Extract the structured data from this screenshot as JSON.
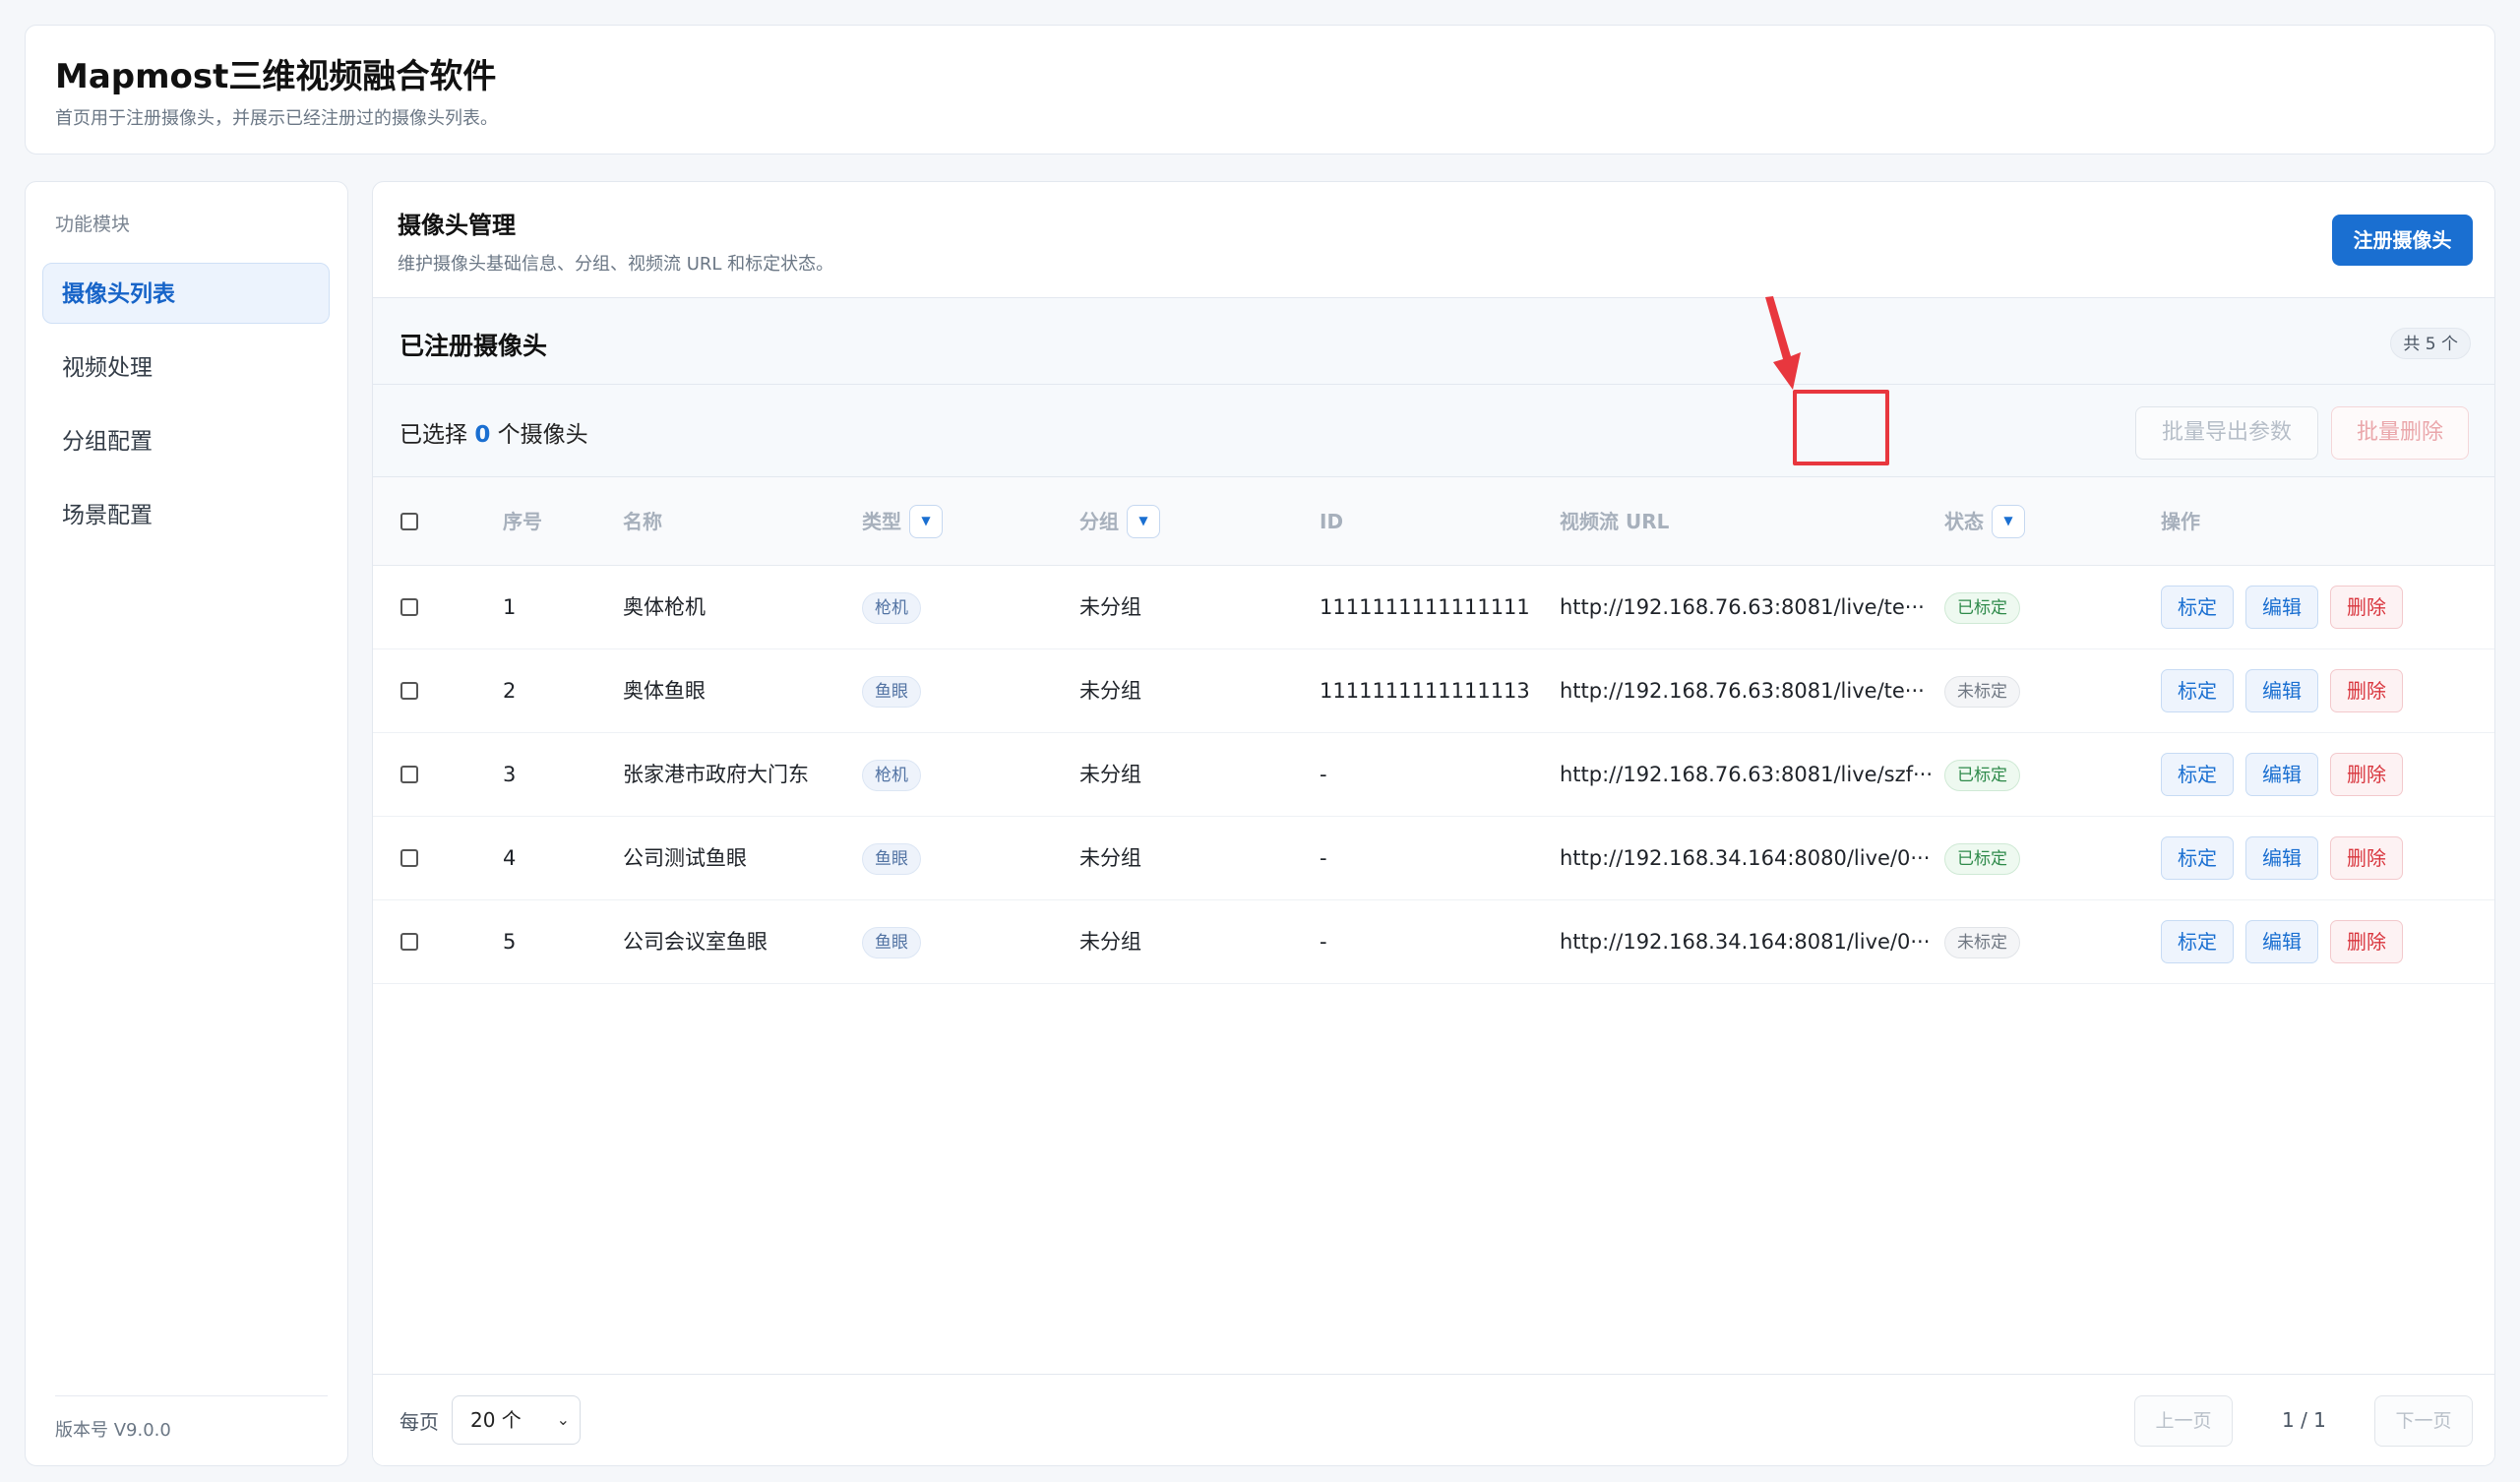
{
  "app": {
    "title": "Mapmost三维视频融合软件",
    "subtitle": "首页用于注册摄像头，并展示已经注册过的摄像头列表。"
  },
  "sidebar": {
    "section_label": "功能模块",
    "items": [
      {
        "label": "摄像头列表",
        "active": true
      },
      {
        "label": "视频处理",
        "active": false
      },
      {
        "label": "分组配置",
        "active": false
      },
      {
        "label": "场景配置",
        "active": false
      }
    ],
    "version": "版本号 V9.0.0"
  },
  "management": {
    "title": "摄像头管理",
    "description": "维护摄像头基础信息、分组、视频流 URL 和标定状态。",
    "register_button": "注册摄像头"
  },
  "list": {
    "title": "已注册摄像头",
    "count_badge": "共 5 个",
    "selection_prefix": "已选择",
    "selection_count": "0",
    "selection_suffix": "个摄像头",
    "export_button": "批量导出参数",
    "batch_delete_button": "批量删除"
  },
  "table": {
    "headers": {
      "index": "序号",
      "name": "名称",
      "type": "类型",
      "group": "分组",
      "id": "ID",
      "url": "视频流 URL",
      "status": "状态",
      "actions": "操作"
    },
    "action_labels": {
      "calibrate": "标定",
      "edit": "编辑",
      "delete": "删除"
    },
    "rows": [
      {
        "index": "1",
        "name": "奥体枪机",
        "type": "枪机",
        "group": "未分组",
        "id": "1111111111111111",
        "url": "http://192.168.76.63:8081/live/te···",
        "status": "已标定",
        "calibrated": true
      },
      {
        "index": "2",
        "name": "奥体鱼眼",
        "type": "鱼眼",
        "group": "未分组",
        "id": "1111111111111113",
        "url": "http://192.168.76.63:8081/live/te···",
        "status": "未标定",
        "calibrated": false
      },
      {
        "index": "3",
        "name": "张家港市政府大门东",
        "type": "枪机",
        "group": "未分组",
        "id": "-",
        "url": "http://192.168.76.63:8081/live/szf···",
        "status": "已标定",
        "calibrated": true
      },
      {
        "index": "4",
        "name": "公司测试鱼眼",
        "type": "鱼眼",
        "group": "未分组",
        "id": "-",
        "url": "http://192.168.34.164:8080/live/0···",
        "status": "已标定",
        "calibrated": true
      },
      {
        "index": "5",
        "name": "公司会议室鱼眼",
        "type": "鱼眼",
        "group": "未分组",
        "id": "-",
        "url": "http://192.168.34.164:8081/live/0···",
        "status": "未标定",
        "calibrated": false
      }
    ]
  },
  "footer": {
    "per_page_label": "每页",
    "per_page_value": "20 个",
    "prev_button": "上一页",
    "page_indicator": "1 / 1",
    "next_button": "下一页"
  },
  "colors": {
    "primary": "#1a6fd1",
    "danger": "#d9363e",
    "annotation": "#e8373e"
  }
}
